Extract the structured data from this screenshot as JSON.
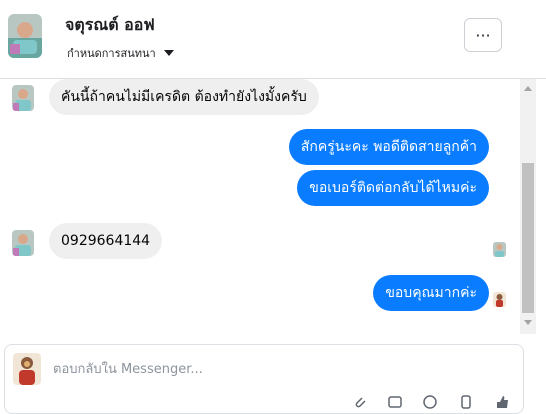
{
  "header": {
    "contact_name": "จตุรณต์ ออฟ",
    "assign_label": "กำหนดการสนทนา",
    "more_label": "···"
  },
  "thread": {
    "messages": [
      {
        "direction": "incoming",
        "text": "คันนี้ถ้าคนไม่มีเครดิต ต้องทำยังไงมั้งครับ"
      },
      {
        "direction": "outgoing",
        "text": "สักครู่นะคะ พอดีติดสายลูกค้า"
      },
      {
        "direction": "outgoing",
        "text": "ขอเบอร์ติดต่อกลับได้ไหมค่ะ"
      },
      {
        "direction": "incoming",
        "text": "0929664144"
      },
      {
        "direction": "outgoing",
        "text": "ขอบคุณมากค่ะ"
      }
    ]
  },
  "composer": {
    "placeholder": "ตอบกลับใน Messenger..."
  },
  "icons": {
    "more": "more-horizontal-icon",
    "caret": "caret-down-icon",
    "tools": [
      "attachment-icon",
      "gif-icon",
      "emoji-icon",
      "sticker-icon",
      "like-icon"
    ]
  },
  "colors": {
    "outgoing_bubble": "#0a7cff",
    "incoming_bubble": "#efefef"
  }
}
